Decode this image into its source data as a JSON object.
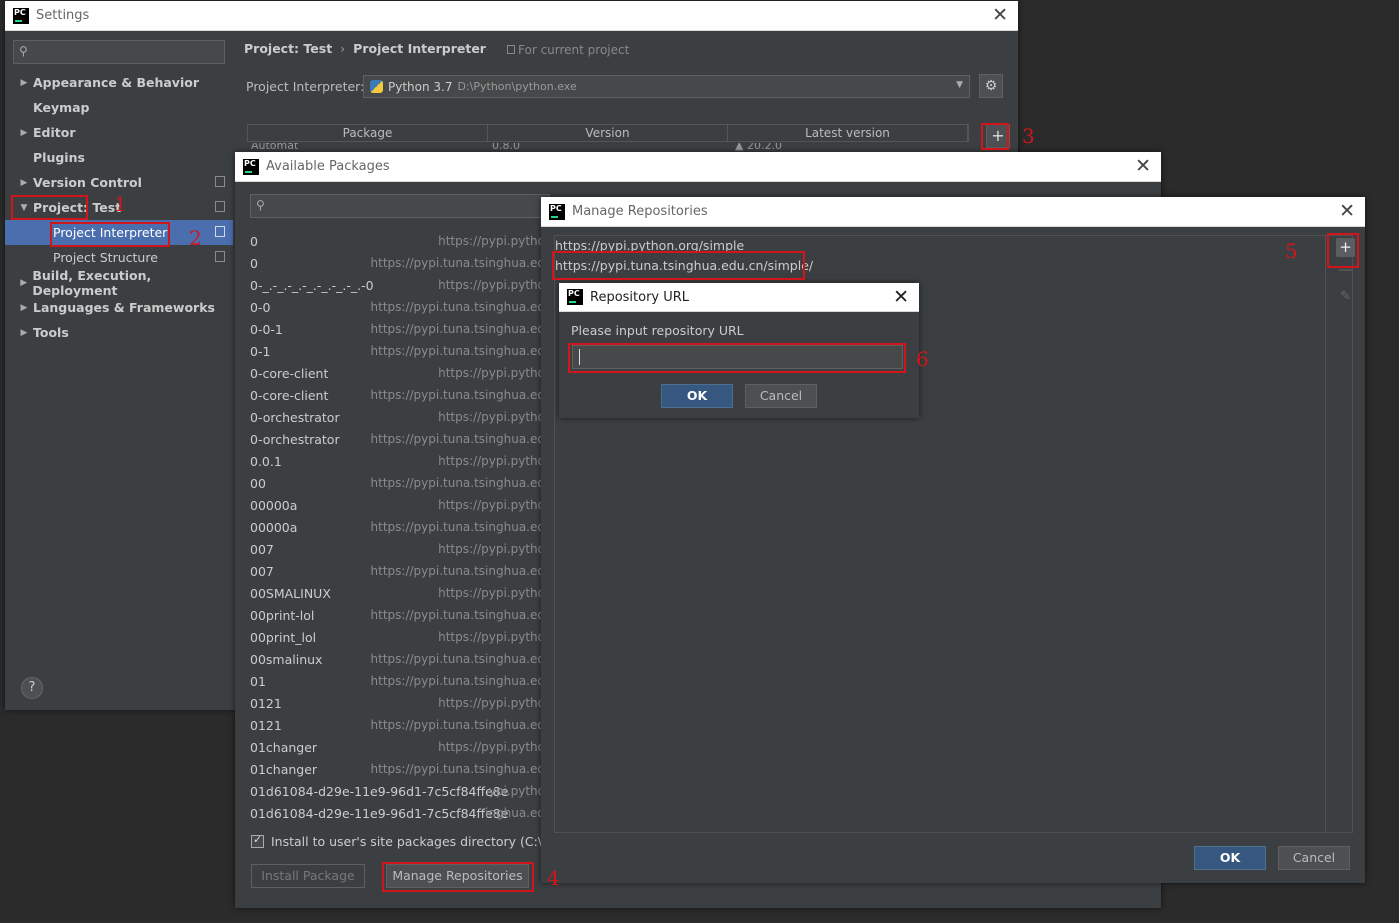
{
  "settings": {
    "title": "Settings",
    "sidebar": {
      "items": [
        {
          "label": "Appearance & Behavior"
        },
        {
          "label": "Keymap"
        },
        {
          "label": "Editor"
        },
        {
          "label": "Plugins"
        },
        {
          "label": "Version Control"
        },
        {
          "label": "Project: Test"
        },
        {
          "label": "Project Interpreter"
        },
        {
          "label": "Project Structure"
        },
        {
          "label": "Build, Execution, Deployment"
        },
        {
          "label": "Languages & Frameworks"
        },
        {
          "label": "Tools"
        }
      ],
      "help": "?"
    },
    "breadcrumb": {
      "project": "Project: Test",
      "sep": "›",
      "page": "Project Interpreter"
    },
    "scope_note": "For current project",
    "interpreter": {
      "label": "Project Interpreter:",
      "name": "Python 3.7",
      "path": "D:\\Python\\python.exe"
    },
    "table": {
      "columns": [
        "Package",
        "Version",
        "Latest version"
      ],
      "peek_row": {
        "package": "Automat",
        "version": "0.8.0",
        "latest": "▲ 20.2.0"
      }
    },
    "add_label": "+"
  },
  "available": {
    "title": "Available Packages",
    "packages": [
      {
        "name": "0",
        "url": "https://pypi.pytho"
      },
      {
        "name": "0",
        "url": "https://pypi.tuna.tsinghua.ed"
      },
      {
        "name": "0-_.-_.-_.-_.-_.-_.-_.-0",
        "url": "https://pypi.pytho"
      },
      {
        "name": "0-0",
        "url": "https://pypi.tuna.tsinghua.ed"
      },
      {
        "name": "0-0-1",
        "url": "https://pypi.tuna.tsinghua.ed"
      },
      {
        "name": "0-1",
        "url": "https://pypi.tuna.tsinghua.ed"
      },
      {
        "name": "0-core-client",
        "url": "https://pypi.pytho"
      },
      {
        "name": "0-core-client",
        "url": "https://pypi.tuna.tsinghua.ed"
      },
      {
        "name": "0-orchestrator",
        "url": "https://pypi.pytho"
      },
      {
        "name": "0-orchestrator",
        "url": "https://pypi.tuna.tsinghua.ed"
      },
      {
        "name": "0.0.1",
        "url": "https://pypi.pytho"
      },
      {
        "name": "00",
        "url": "https://pypi.tuna.tsinghua.ed"
      },
      {
        "name": "00000a",
        "url": "https://pypi.pytho"
      },
      {
        "name": "00000a",
        "url": "https://pypi.tuna.tsinghua.ed"
      },
      {
        "name": "007",
        "url": "https://pypi.pytho"
      },
      {
        "name": "007",
        "url": "https://pypi.tuna.tsinghua.ed"
      },
      {
        "name": "00SMALINUX",
        "url": "https://pypi.pytho"
      },
      {
        "name": "00print-lol",
        "url": "https://pypi.tuna.tsinghua.ed"
      },
      {
        "name": "00print_lol",
        "url": "https://pypi.pytho"
      },
      {
        "name": "00smalinux",
        "url": "https://pypi.tuna.tsinghua.ed"
      },
      {
        "name": "01",
        "url": "https://pypi.tuna.tsinghua.ed"
      },
      {
        "name": "0121",
        "url": "https://pypi.pytho"
      },
      {
        "name": "0121",
        "url": "https://pypi.tuna.tsinghua.ed"
      },
      {
        "name": "01changer",
        "url": "https://pypi.pytho"
      },
      {
        "name": "01changer",
        "url": "https://pypi.tuna.tsinghua.ed"
      },
      {
        "name": "01d61084-d29e-11e9-96d1-7c5cf84ffe8e",
        "url": "ypi.pytho"
      },
      {
        "name": "01d61084-d29e-11e9-96d1-7c5cf84ffe8e",
        "url": "inghua.ed"
      }
    ],
    "install_option": "Install to user's site packages directory (C:\\Use",
    "install_button": "Install Package",
    "manage_button": "Manage Repositories"
  },
  "repos": {
    "title": "Manage Repositories",
    "items": [
      "https://pypi.python.org/simple",
      "https://pypi.tuna.tsinghua.edu.cn/simple/"
    ],
    "add_label": "+",
    "remove_label": "—",
    "edit_label": "✎",
    "ok": "OK",
    "cancel": "Cancel"
  },
  "repo_url": {
    "title": "Repository URL",
    "prompt": "Please input repository URL",
    "value": "",
    "ok": "OK",
    "cancel": "Cancel"
  },
  "annotations": [
    "1",
    "2",
    "3",
    "4",
    "5",
    "6"
  ],
  "colors": {
    "annotation": "#d0161a",
    "selection": "#4b6eaf",
    "primary_button": "#365880",
    "panel": "#3c3f41"
  }
}
